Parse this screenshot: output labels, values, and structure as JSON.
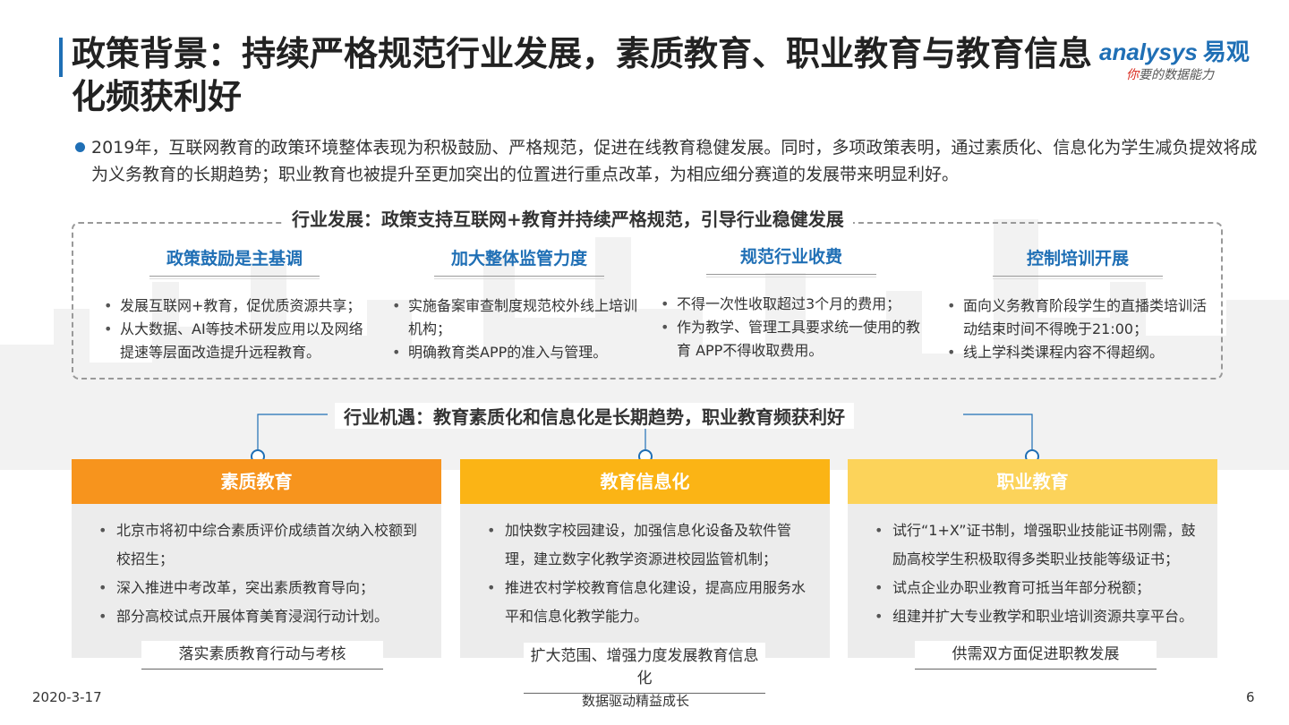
{
  "title": "政策背景：持续严格规范行业发展，素质教育、职业教育与教育信息化频获利好",
  "logo": {
    "brand": "analysys",
    "brand_cn": "易观",
    "slogan_red": "你",
    "slogan": "要的数据能力"
  },
  "intro": "2019年，互联网教育的政策环境整体表现为积极鼓励、严格规范，促进在线教育稳健发展。同时，多项政策表明，通过素质化、信息化为学生减负提效将成为义务教育的长期趋势；职业教育也被提升至更加突出的位置进行重点改革，为相应细分赛道的发展带来明显利好。",
  "section1": {
    "title": "行业发展：政策支持互联网+教育并持续严格规范，引导行业稳健发展",
    "columns": [
      {
        "head": "政策鼓励是主基调",
        "items": [
          "发展互联网+教育，促优质资源共享；",
          "从大数据、AI等技术研发应用以及网络提速等层面改造提升远程教育。"
        ]
      },
      {
        "head": "加大整体监管力度",
        "items": [
          "实施备案审查制度规范校外线上培训机构；",
          "明确教育类APP的准入与管理。"
        ]
      },
      {
        "head": "规范行业收费",
        "items": [
          "不得一次性收取超过3个月的费用；",
          "作为教学、管理工具要求统一使用的教育 APP不得收取费用。"
        ]
      },
      {
        "head": "控制培训开展",
        "items": [
          "面向义务教育阶段学生的直播类培训活动结束时间不得晚于21:00；",
          "线上学科类课程内容不得超纲。"
        ]
      }
    ]
  },
  "section2": {
    "title": "行业机遇：教育素质化和信息化是长期趋势，职业教育频获利好",
    "cards": [
      {
        "head": "素质教育",
        "color": "#f7941d",
        "items": [
          "北京市将初中综合素质评价成绩首次纳入校额到校招生；",
          "深入推进中考改革，突出素质教育导向；",
          "部分高校试点开展体育美育浸润行动计划。"
        ],
        "foot": "落实素质教育行动与考核"
      },
      {
        "head": "教育信息化",
        "color": "#fbb415",
        "items": [
          "加快数字校园建设，加强信息化设备及软件管理，建立数字化教学资源进校园监管机制；",
          "推进农村学校教育信息化建设，提高应用服务水平和信息化教学能力。"
        ],
        "foot": "扩大范围、增强力度发展教育信息化"
      },
      {
        "head": "职业教育",
        "color": "#fcd35a",
        "items": [
          "试行“1+X”证书制，增强职业技能证书刚需，鼓励高校学生积极取得多类职业技能等级证书；",
          "试点企业办职业教育可抵当年部分税额；",
          "组建并扩大专业教学和职业培训资源共享平台。"
        ],
        "foot": "供需双方面促进职教发展"
      }
    ]
  },
  "footer": {
    "date": "2020-3-17",
    "center": "数据驱动精益成长",
    "page": "6"
  }
}
